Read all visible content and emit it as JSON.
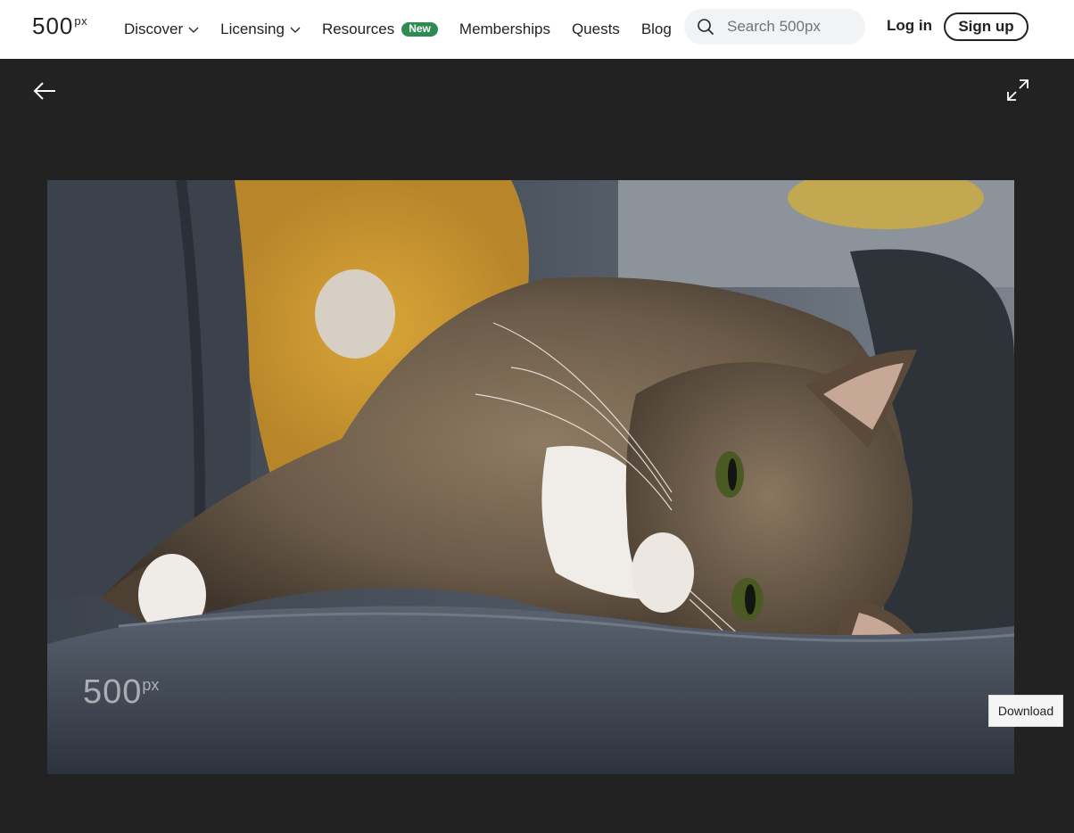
{
  "header": {
    "logo_main": "500",
    "logo_sup": "px",
    "nav": [
      {
        "label": "Discover",
        "has_dropdown": true
      },
      {
        "label": "Licensing",
        "has_dropdown": true
      },
      {
        "label": "Resources",
        "badge": "New"
      },
      {
        "label": "Memberships"
      },
      {
        "label": "Quests"
      },
      {
        "label": "Blog"
      }
    ],
    "search_placeholder": "Search 500px",
    "login_label": "Log in",
    "signup_label": "Sign up"
  },
  "viewer": {
    "back_icon": "arrow-left-icon",
    "expand_icon": "expand-icon",
    "watermark_main": "500",
    "watermark_sup": "px",
    "download_label": "Download"
  },
  "colors": {
    "background": "#222222",
    "header_bg": "#ffffff",
    "badge_green": "#2c8c51"
  }
}
